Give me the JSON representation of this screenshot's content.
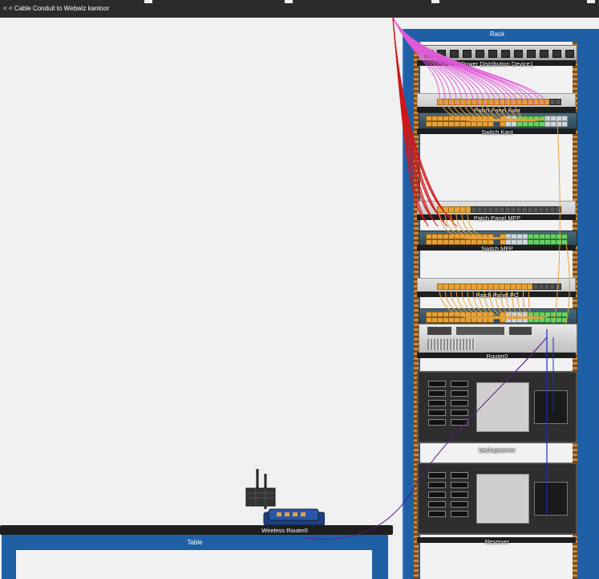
{
  "window": {
    "back_link": "< < Cable Conduit to Webwiz kantoor"
  },
  "rack": {
    "title": "Rack",
    "devices": [
      {
        "id": "pdu",
        "label": "Power Distribution Device1"
      },
      {
        "id": "patch-panel-1",
        "label": "Patch Panel Kant"
      },
      {
        "id": "switch-1",
        "label": "Switch Kant"
      },
      {
        "id": "patch-panel-mfp",
        "label": "Patch Panel MFP"
      },
      {
        "id": "switch-mfp",
        "label": "Switch MFP"
      },
      {
        "id": "patch-panel-pc",
        "label": "Patch Panel PC"
      },
      {
        "id": "router0",
        "label": "Router0"
      },
      {
        "id": "backupserver",
        "label": "backupserver"
      },
      {
        "id": "fileserver",
        "label": "fileserver"
      }
    ]
  },
  "table": {
    "label": "Table",
    "device_label": "Wireless Router0"
  },
  "colors": {
    "rack_blue": "#1f5fa6",
    "cable_magenta": "#e05ad8",
    "cable_red": "#d01818",
    "cable_orange": "#e6a23c",
    "cable_blue": "#1a2ad0",
    "cable_purple": "#5a1a8a"
  }
}
